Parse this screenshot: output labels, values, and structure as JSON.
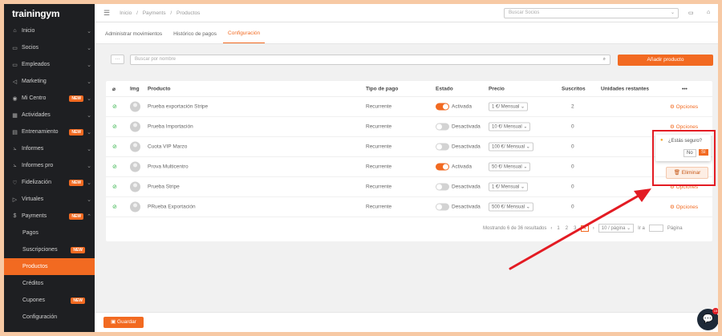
{
  "sidebar": {
    "brand": "trainingym",
    "items": [
      {
        "icon": "home-icon",
        "glyph": "⌂",
        "label": "Inicio"
      },
      {
        "icon": "card-icon",
        "glyph": "▭",
        "label": "Socios"
      },
      {
        "icon": "card-icon",
        "glyph": "▭",
        "label": "Empleados"
      },
      {
        "icon": "megaphone-icon",
        "glyph": "◁",
        "label": "Marketing"
      },
      {
        "icon": "pin-icon",
        "glyph": "◉",
        "label": "Mi Centro",
        "badge": "NEW"
      },
      {
        "icon": "calendar-icon",
        "glyph": "▦",
        "label": "Actividades"
      },
      {
        "icon": "dumbbell-icon",
        "glyph": "▤",
        "label": "Entrenamiento",
        "badge": "NEW"
      },
      {
        "icon": "chart-icon",
        "glyph": "⦣",
        "label": "Informes"
      },
      {
        "icon": "chart-icon",
        "glyph": "⦣",
        "label": "Informes pro"
      },
      {
        "icon": "heart-icon",
        "glyph": "♡",
        "label": "Fidelización",
        "badge": "NEW"
      },
      {
        "icon": "video-icon",
        "glyph": "▷",
        "label": "Virtuales"
      },
      {
        "icon": "dollar-icon",
        "glyph": "$",
        "label": "Payments",
        "badge": "NEW"
      }
    ],
    "sub_items": [
      {
        "label": "Pagos"
      },
      {
        "label": "Suscripciones",
        "badge": "NEW"
      },
      {
        "label": "Productos",
        "active": true
      },
      {
        "label": "Créditos"
      },
      {
        "label": "Cupones",
        "badge": "NEW"
      },
      {
        "label": "Configuración"
      }
    ]
  },
  "topbar": {
    "breadcrumb": [
      "Inicio",
      "/",
      "Payments",
      "/",
      "Productos"
    ],
    "search_placeholder": "Buscar Socios"
  },
  "tabs": [
    "Administrar movimientos",
    "Histórico de pagos",
    "Configuración"
  ],
  "active_tab": 2,
  "filter": {
    "dots": "···",
    "search_placeholder": "Buscar por nombre",
    "add_button": "Añadir producto"
  },
  "table": {
    "headers": [
      "Img",
      "Producto",
      "Tipo de pago",
      "Estado",
      "Precio",
      "Suscritos",
      "Unidades restantes",
      "•••"
    ],
    "rows": [
      {
        "product": "Prueba exportación Stripe",
        "type": "Recurrente",
        "enabled": true,
        "status": "Activada",
        "price": "1 €/ Mensual",
        "subs": "2",
        "options": "Opciones"
      },
      {
        "product": "Prueba Importación",
        "type": "Recurrente",
        "enabled": false,
        "status": "Desactivada",
        "price": "10 €/ Mensual",
        "subs": "0",
        "options": "Opciones"
      },
      {
        "product": "Cuota VIP Marzo",
        "type": "Recurrente",
        "enabled": false,
        "status": "Desactivada",
        "price": "100 €/ Mensual",
        "subs": "0",
        "options": ""
      },
      {
        "product": "Prova Multicentro",
        "type": "Recurrente",
        "enabled": true,
        "status": "Activada",
        "price": "50 €/ Mensual",
        "subs": "0",
        "options": ""
      },
      {
        "product": "Prueba Stripe",
        "type": "Recurrente",
        "enabled": false,
        "status": "Desactivada",
        "price": "1 €/ Mensual",
        "subs": "0",
        "options": "Opciones"
      },
      {
        "product": "PRueba Exportación",
        "type": "Recurrente",
        "enabled": false,
        "status": "Desactivada",
        "price": "500 €/ Mensual",
        "subs": "0",
        "options": "Opciones"
      }
    ]
  },
  "pagination": {
    "summary": "Mostrando 6 de 36 resultados",
    "pages": [
      "1",
      "2",
      "3",
      "4"
    ],
    "active_page": "4",
    "per_page": "10 / página",
    "goto_label": "Ir a",
    "page_label": "Página"
  },
  "popconfirm": {
    "question": "¿Estás seguro?",
    "no": "No",
    "yes": "Sí"
  },
  "delete_label": "Eliminar",
  "save_label": "Guardar",
  "chat_badge": "15",
  "colors": {
    "accent": "#f26a21",
    "annotation": "#e31b23",
    "sidebar": "#1e1f22"
  }
}
